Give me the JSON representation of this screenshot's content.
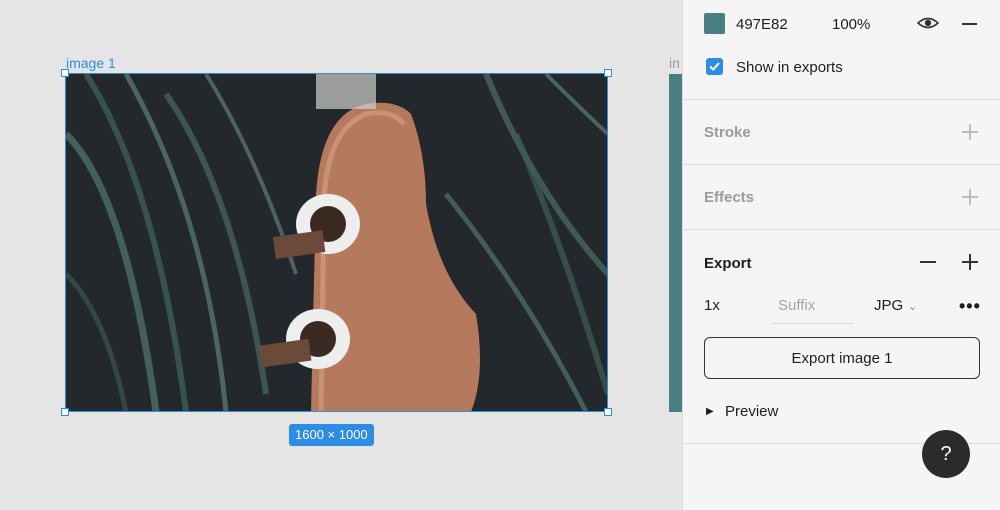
{
  "canvas": {
    "frame_name": "image 1",
    "next_frame_name": "in",
    "size_badge": "1600 × 1000"
  },
  "fill": {
    "hex": "497E82",
    "opacity": "100%",
    "color": "#497E82"
  },
  "show_in_exports": {
    "checked": true,
    "label": "Show in exports"
  },
  "sections": {
    "stroke": "Stroke",
    "effects": "Effects",
    "export": "Export"
  },
  "export_settings": {
    "scale": "1x",
    "suffix_placeholder": "Suffix",
    "format": "JPG",
    "button_label": "Export image 1"
  },
  "preview": {
    "label": "Preview"
  },
  "help": {
    "label": "?"
  },
  "colors": {
    "accent": "#2d8ce4",
    "swatch": "#497E82"
  }
}
